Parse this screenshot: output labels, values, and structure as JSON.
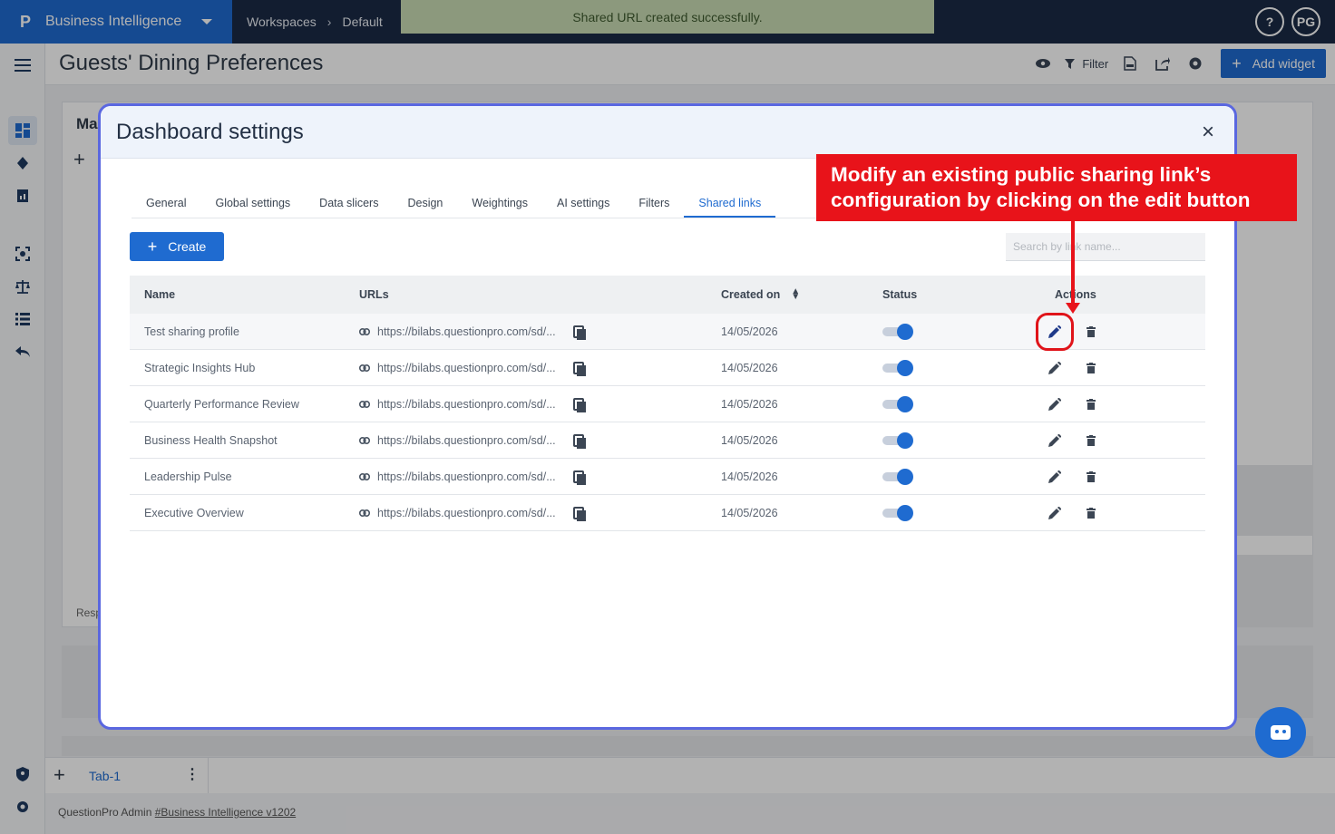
{
  "topbar": {
    "logo": "P",
    "app_title": "Business Intelligence",
    "breadcrumb": [
      "Workspaces",
      "Default"
    ],
    "toast": "Shared URL created successfully.",
    "help_label": "?",
    "user_initials": "PG"
  },
  "page": {
    "title": "Guests' Dining Preferences",
    "filter_label": "Filter",
    "add_widget_label": "Add widget",
    "widget_title_partial": "Ma",
    "widget_footer_partial": "Resp"
  },
  "bottom": {
    "tab_label": "Tab-1",
    "footer_text": "QuestionPro Admin ",
    "footer_link": "#Business Intelligence v1202"
  },
  "modal": {
    "title": "Dashboard settings",
    "close_label": "×",
    "tabs": [
      "General",
      "Global settings",
      "Data slicers",
      "Design",
      "Weightings",
      "AI settings",
      "Filters",
      "Shared links"
    ],
    "active_tab": "Shared links",
    "create_label": "Create",
    "search_placeholder": "Search by link name...",
    "columns": {
      "name": "Name",
      "urls": "URLs",
      "created_on": "Created on",
      "status": "Status",
      "actions": "Actions"
    },
    "rows": [
      {
        "name": "Test sharing profile",
        "url": "https://bilabs.questionpro.com/sd/...",
        "created": "14/05/2026",
        "status": "on"
      },
      {
        "name": "Strategic Insights Hub",
        "url": "https://bilabs.questionpro.com/sd/...",
        "created": "14/05/2026",
        "status": "on"
      },
      {
        "name": "Quarterly Performance Review",
        "url": "https://bilabs.questionpro.com/sd/...",
        "created": "14/05/2026",
        "status": "on"
      },
      {
        "name": "Business Health Snapshot",
        "url": "https://bilabs.questionpro.com/sd/...",
        "created": "14/05/2026",
        "status": "on"
      },
      {
        "name": "Leadership Pulse",
        "url": "https://bilabs.questionpro.com/sd/...",
        "created": "14/05/2026",
        "status": "on"
      },
      {
        "name": "Executive Overview",
        "url": "https://bilabs.questionpro.com/sd/...",
        "created": "14/05/2026",
        "status": "on"
      }
    ]
  },
  "callout": {
    "text": "Modify an existing public sharing link’s configuration by clicking on the edit button"
  },
  "colors": {
    "accent": "#1f6bd0",
    "callout": "#e8131a",
    "modal_border": "#5a67e0",
    "toast_bg": "#c9dcb4"
  },
  "icons": [
    "menu-icon",
    "dashboard-icon",
    "diamond-icon",
    "report-icon",
    "scan-icon",
    "balance-icon",
    "list-icon",
    "undo-icon",
    "eye-icon",
    "filter-icon",
    "pdf-icon",
    "share-icon",
    "gear-icon",
    "link-icon",
    "copy-icon",
    "edit-icon",
    "delete-icon",
    "sort-icon",
    "bot-icon",
    "shield-icon"
  ]
}
